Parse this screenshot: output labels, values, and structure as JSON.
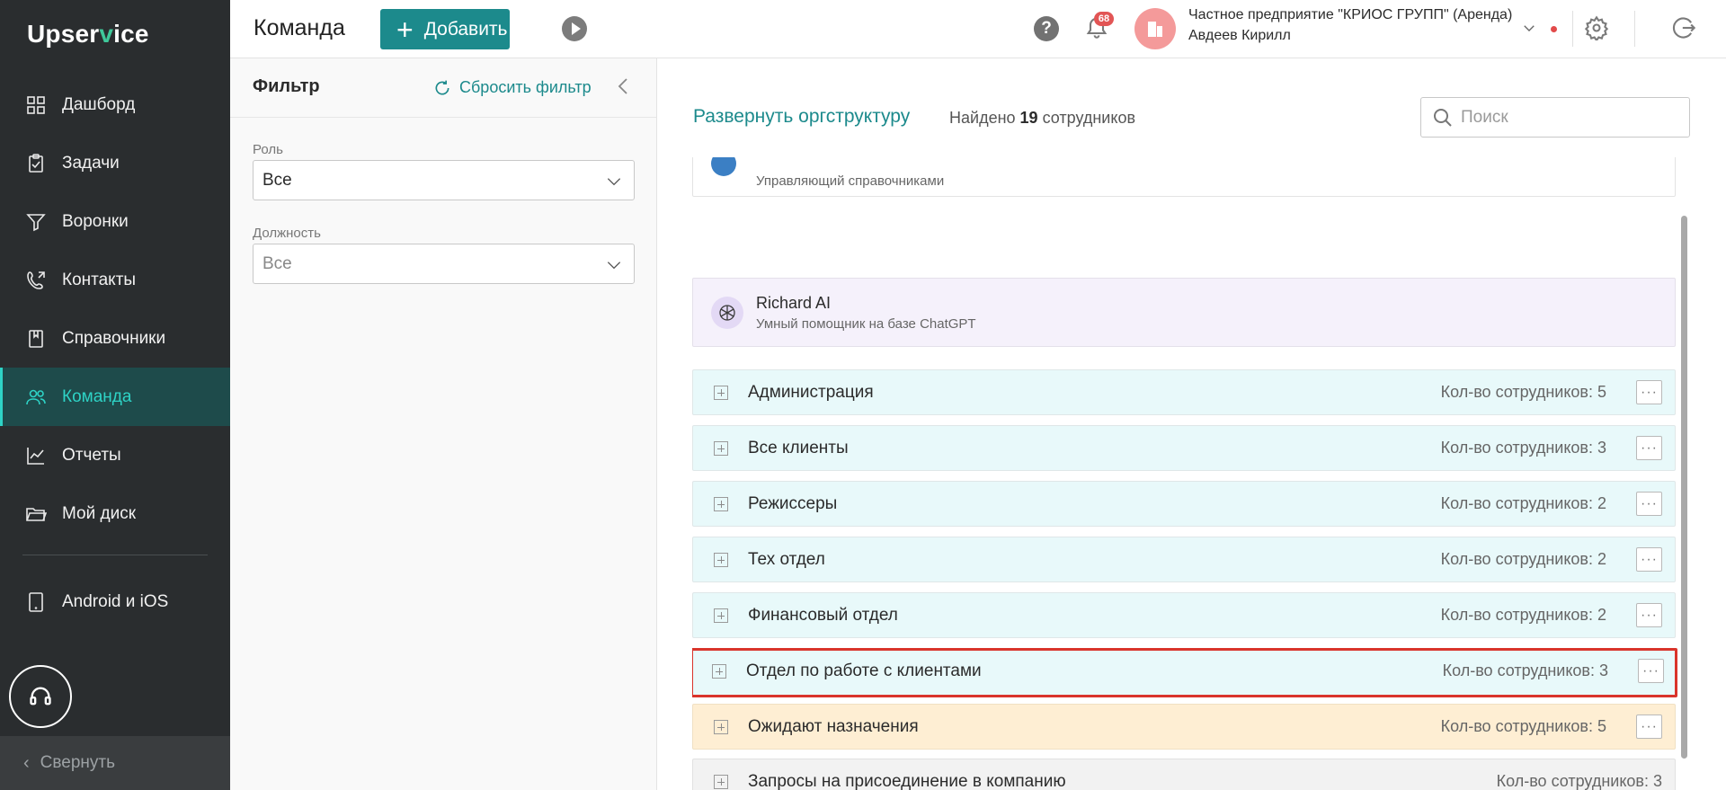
{
  "app": {
    "logo_part1": "Upser",
    "logo_part2": "v",
    "logo_part3": "ice"
  },
  "sidebar": {
    "items": [
      {
        "label": "Дашборд",
        "icon": "dashboard-icon"
      },
      {
        "label": "Задачи",
        "icon": "tasks-icon"
      },
      {
        "label": "Воронки",
        "icon": "funnel-icon"
      },
      {
        "label": "Контакты",
        "icon": "contacts-icon"
      },
      {
        "label": "Справочники",
        "icon": "book-icon"
      },
      {
        "label": "Команда",
        "icon": "team-icon",
        "active": true
      },
      {
        "label": "Отчеты",
        "icon": "chart-icon"
      },
      {
        "label": "Мой диск",
        "icon": "folder-icon"
      }
    ],
    "mobile_label": "Android и iOS",
    "collapse_label": "Свернуть"
  },
  "header": {
    "title": "Команда",
    "add_label": "Добавить",
    "notifications_count": "68",
    "company_name": "Частное предприятие \"КРИОС ГРУПП\" (Аренда)",
    "user_name": "Авдеев Кирилл"
  },
  "filter": {
    "title": "Фильтр",
    "reset_label": "Сбросить фильтр",
    "role_label": "Роль",
    "role_value": "Все",
    "position_label": "Должность",
    "position_value": "Все"
  },
  "main": {
    "expand_label": "Развернуть оргструктуру",
    "found_prefix": "Найдено",
    "found_count": "19",
    "found_suffix": "сотрудников",
    "search_placeholder": "Поиск",
    "partial_member_role": "Управляющий справочниками",
    "assistant": {
      "name": "Richard AI",
      "description": "Умный помощник на базе ChatGPT"
    },
    "departments": [
      {
        "name": "Администрация",
        "count": "Кол-во сотрудников: 5"
      },
      {
        "name": "Все клиенты",
        "count": "Кол-во сотрудников: 3"
      },
      {
        "name": "Режиссеры",
        "count": "Кол-во сотрудников: 2"
      },
      {
        "name": "Тех отдел",
        "count": "Кол-во сотрудников: 2"
      },
      {
        "name": "Финансовый отдел",
        "count": "Кол-во сотрудников: 2"
      },
      {
        "name": "Отдел по работе с клиентами",
        "count": "Кол-во сотрудников: 3",
        "highlighted": true
      },
      {
        "name": "Ожидают назначения",
        "count": "Кол-во сотрудников: 5"
      },
      {
        "name": "Запросы на присоединение в компанию",
        "count": "Кол-во сотрудников: 3"
      }
    ],
    "more_label": "···"
  },
  "colors": {
    "accent": "#1c8a8c",
    "sidebar_bg": "#2a2d2f",
    "active_item": "#2ed3c6",
    "dept_bg": "#e8f9fa",
    "waiting_bg": "#feeed3",
    "highlight_border": "#d9342b"
  }
}
